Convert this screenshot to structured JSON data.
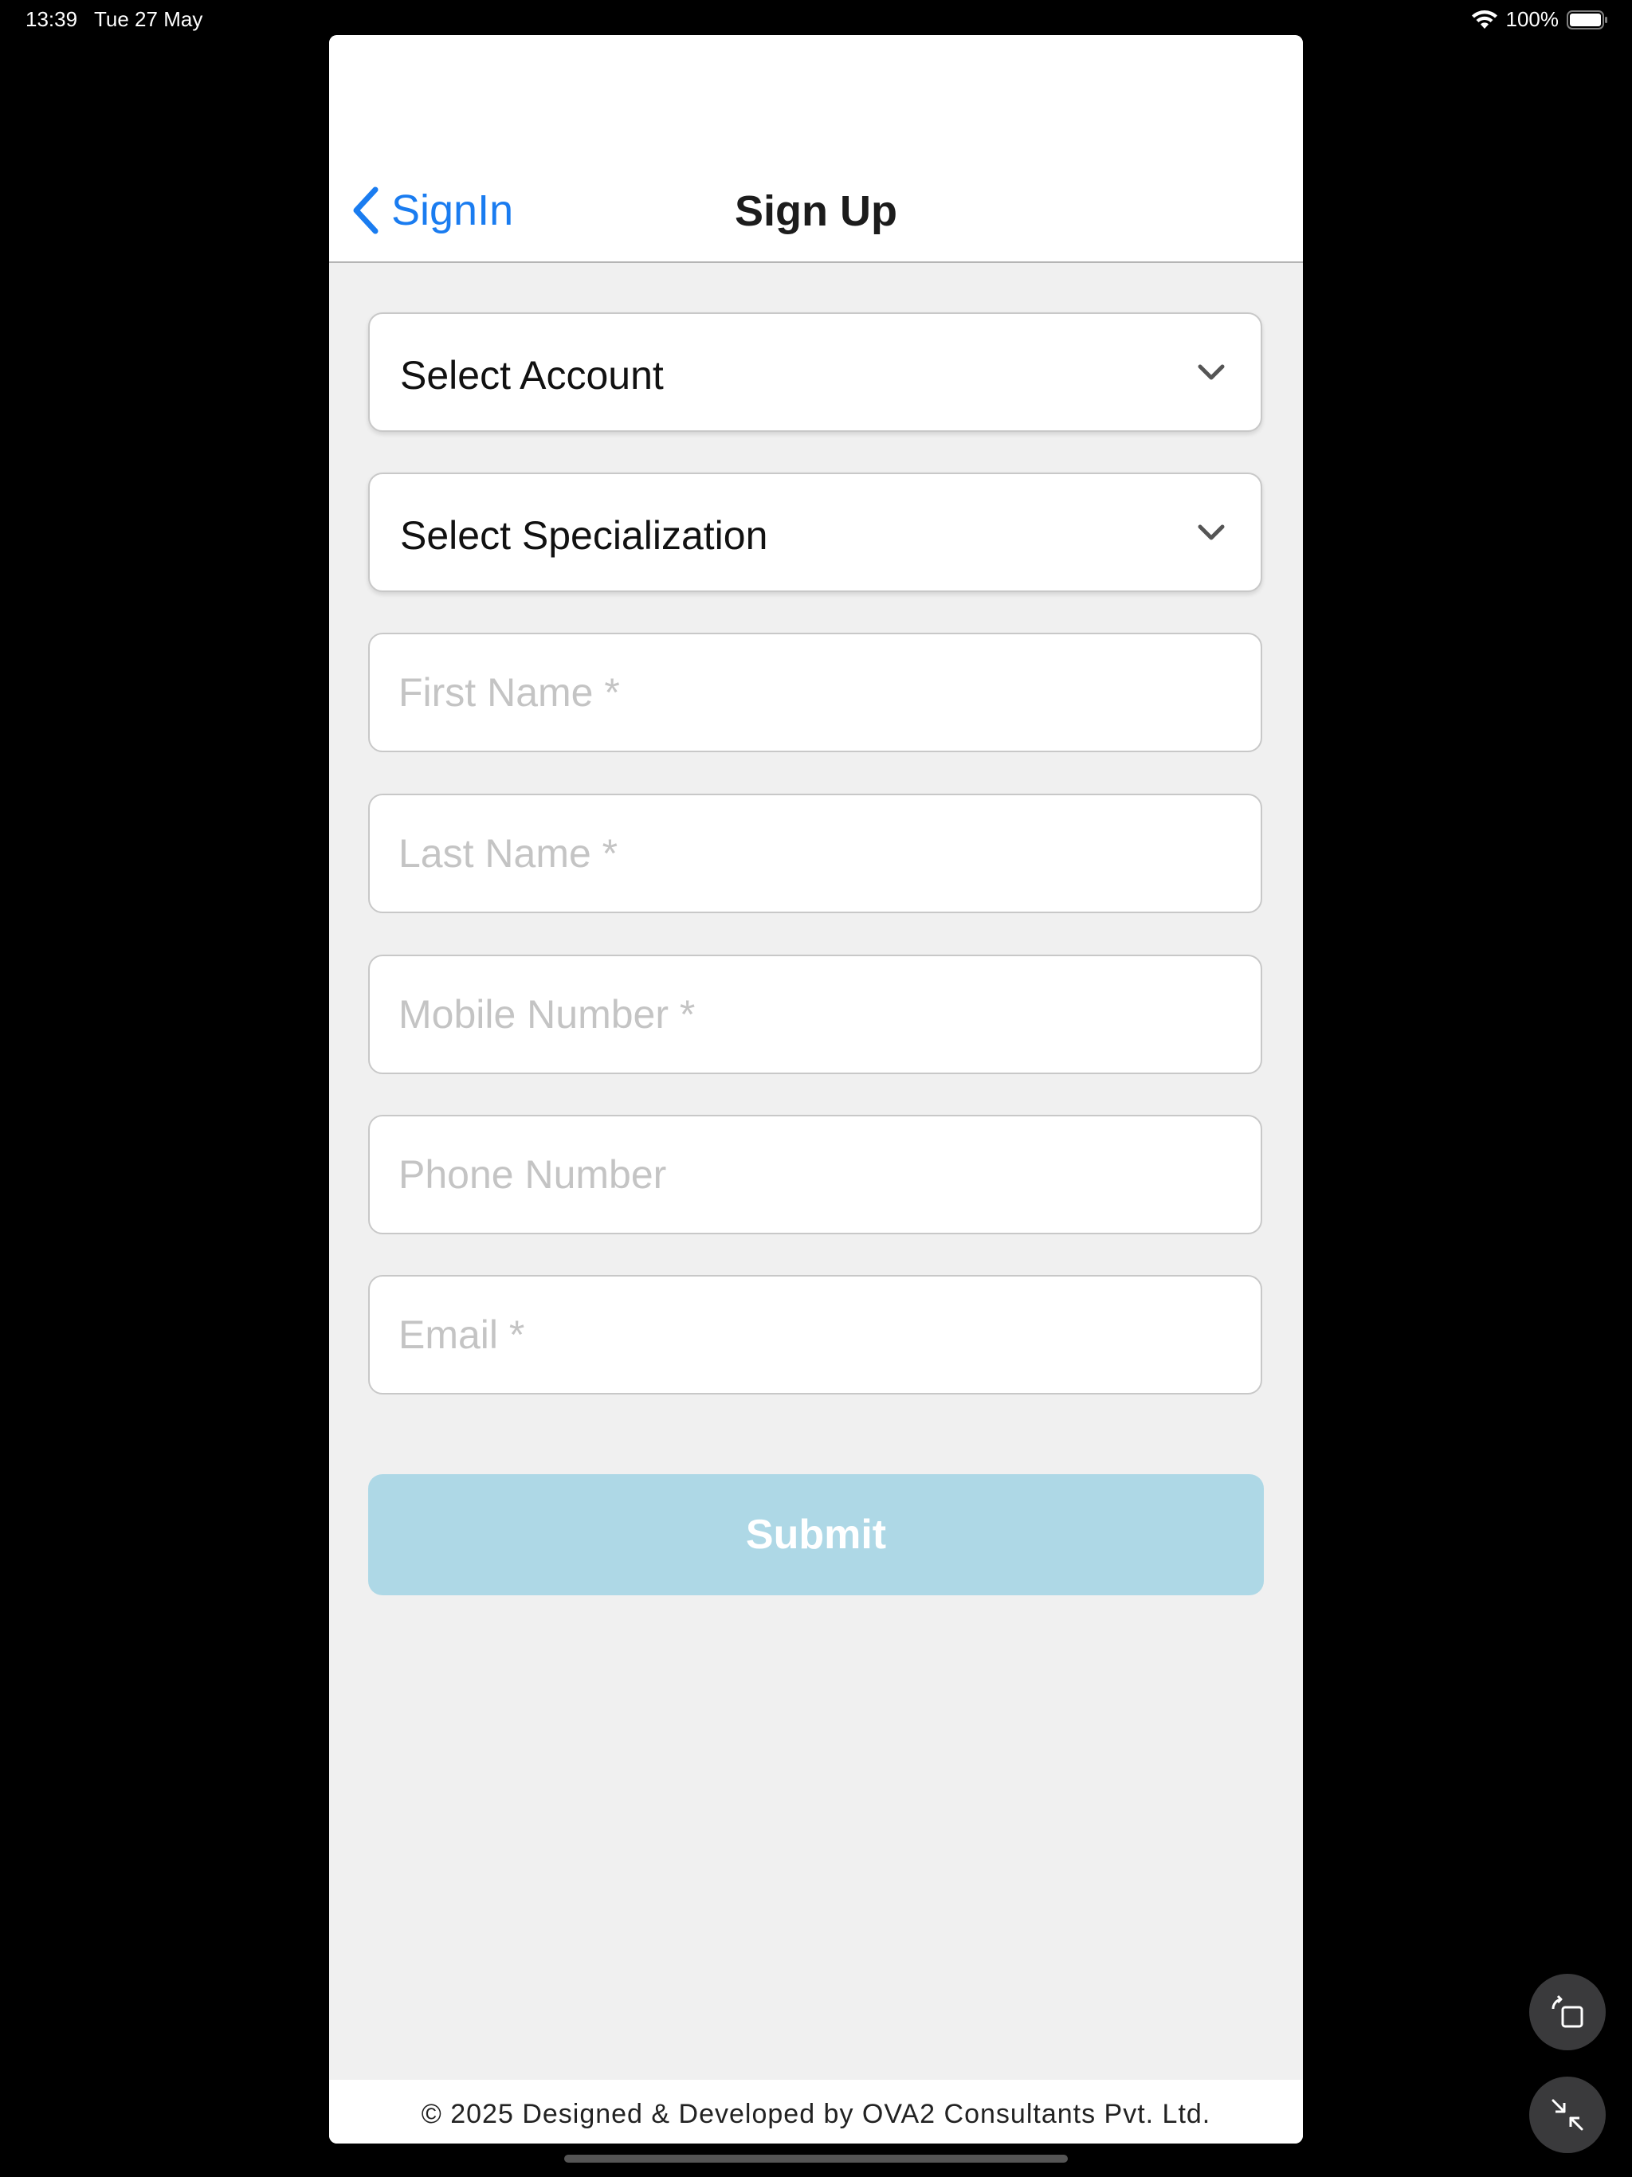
{
  "status_bar": {
    "time": "13:39",
    "date": "Tue 27 May",
    "battery": "100%"
  },
  "nav": {
    "back_label": "SignIn",
    "title": "Sign Up"
  },
  "form": {
    "account_select": "Select Account",
    "specialization_select": "Select Specialization",
    "first_name_placeholder": "First Name *",
    "last_name_placeholder": "Last Name *",
    "mobile_placeholder": "Mobile Number *",
    "phone_placeholder": "Phone Number",
    "email_placeholder": "Email *",
    "submit_label": "Submit"
  },
  "footer": {
    "text": "© 2025 Designed & Developed by OVA2 Consultants Pvt. Ltd."
  },
  "colors": {
    "accent": "#1a7cf0",
    "submit_bg": "#aed8e6",
    "page_bg": "#f0f0f0"
  },
  "icons": [
    "wifi-icon",
    "battery-icon",
    "back-chevron-icon",
    "chevron-down-icon",
    "rotate-icon",
    "minimize-icon"
  ]
}
